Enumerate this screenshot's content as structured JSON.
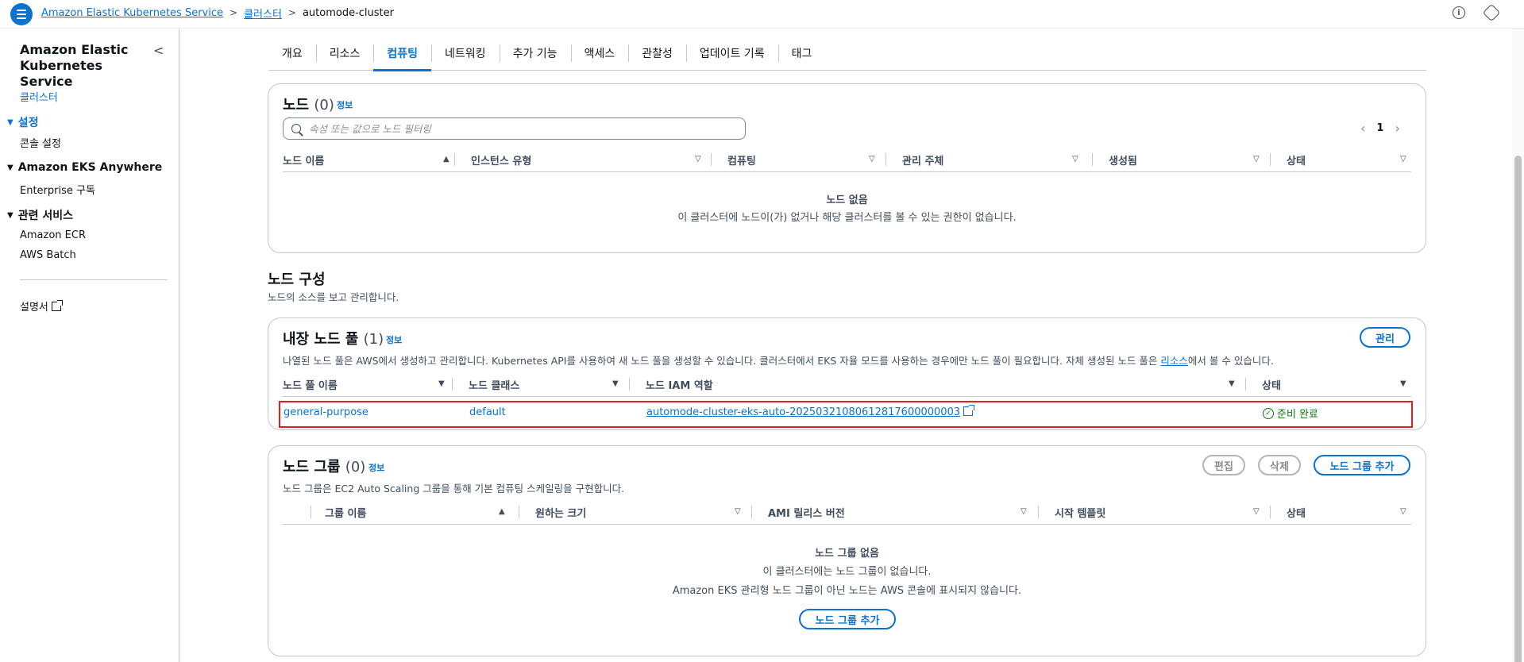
{
  "breadcrumb": {
    "service": "Amazon Elastic Kubernetes Service",
    "clusters": "클러스터",
    "current": "automode-cluster",
    "separator": ">"
  },
  "topbar": {
    "info_icon": "info-icon",
    "settings_icon": "settings-icon"
  },
  "sidebar": {
    "title": "Amazon Elastic Kubernetes Service",
    "collapse_glyph": "<",
    "clusters": "클러스터",
    "settings_section": "설정",
    "console_settings": "콘솔 설정",
    "anywhere_section": "Amazon EKS Anywhere",
    "enterprise": "Enterprise 구독",
    "related_section": "관련 서비스",
    "ecr": "Amazon ECR",
    "batch": "AWS Batch",
    "docs": "설명서"
  },
  "tabs": [
    "개요",
    "리소스",
    "컴퓨팅",
    "네트워킹",
    "추가 기능",
    "액세스",
    "관찰성",
    "업데이트 기록",
    "태그"
  ],
  "active_tab": "컴퓨팅",
  "nodes": {
    "title": "노드",
    "count": "(0)",
    "info": "정보",
    "search_placeholder": "속성 또는 값으로 노드 필터링",
    "pager": {
      "prev": "‹",
      "page": "1",
      "next": "›"
    },
    "columns": [
      "노드 이름",
      "인스턴스 유형",
      "컴퓨팅",
      "관리 주체",
      "생성됨",
      "상태"
    ],
    "sort_glyphs": {
      "asc": "▲",
      "menu": "▽"
    },
    "empty_title": "노드 없음",
    "empty_text": "이 클러스터에 노드이(가) 없거나 해당 클러스터를 볼 수 있는 권한이 없습니다."
  },
  "node_config": {
    "title": "노드 구성",
    "description": "노드의 소스를 보고 관리합니다."
  },
  "node_pools": {
    "title": "내장 노드 풀",
    "count": "(1)",
    "info": "정보",
    "manage_button": "관리",
    "description_prefix": "나열된 노드 풀은 AWS에서 생성하고 관리합니다. Kubernetes API를 사용하여 새 노드 풀을 생성할 수 있습니다. 클러스터에서 EKS 자율 모드를 사용하는 경우에만 노드 풀이 필요합니다. 자체 생성된 노드 풀은 ",
    "description_link": "리소스",
    "description_suffix": "에서 볼 수 있습니다.",
    "columns": [
      "노드 풀 이름",
      "노드 클래스",
      "노드 IAM 역할",
      "상태"
    ],
    "sort_glyph": "▼",
    "rows": [
      {
        "name": "general-purpose",
        "node_class": "default",
        "iam_role": "automode-cluster-eks-auto-20250321080612817600000003",
        "status": "준비 완료",
        "status_glyph": "✓"
      }
    ]
  },
  "node_groups": {
    "title": "노드 그룹",
    "count": "(0)",
    "info": "정보",
    "edit_button": "편집",
    "delete_button": "삭제",
    "add_button": "노드 그룹 추가",
    "description": "노드 그룹은 EC2 Auto Scaling 그룹을 통해 기본 컴퓨팅 스케일링을 구현합니다.",
    "columns": [
      "그룹 이름",
      "원하는 크기",
      "AMI 릴리스 버전",
      "시작 템플릿",
      "상태"
    ],
    "empty_title": "노드 그룹 없음",
    "empty_text_1": "이 클러스터에는 노드 그룹이 없습니다.",
    "empty_text_2": "Amazon EKS 관리형 노드 그룹이 아닌 노드는 AWS 콘솔에 표시되지 않습니다.",
    "empty_add_button": "노드 그룹 추가"
  },
  "colors": {
    "link": "#0972d3",
    "success": "#037f0c",
    "highlight": "#e0201d",
    "border": "#c6c6cd"
  }
}
